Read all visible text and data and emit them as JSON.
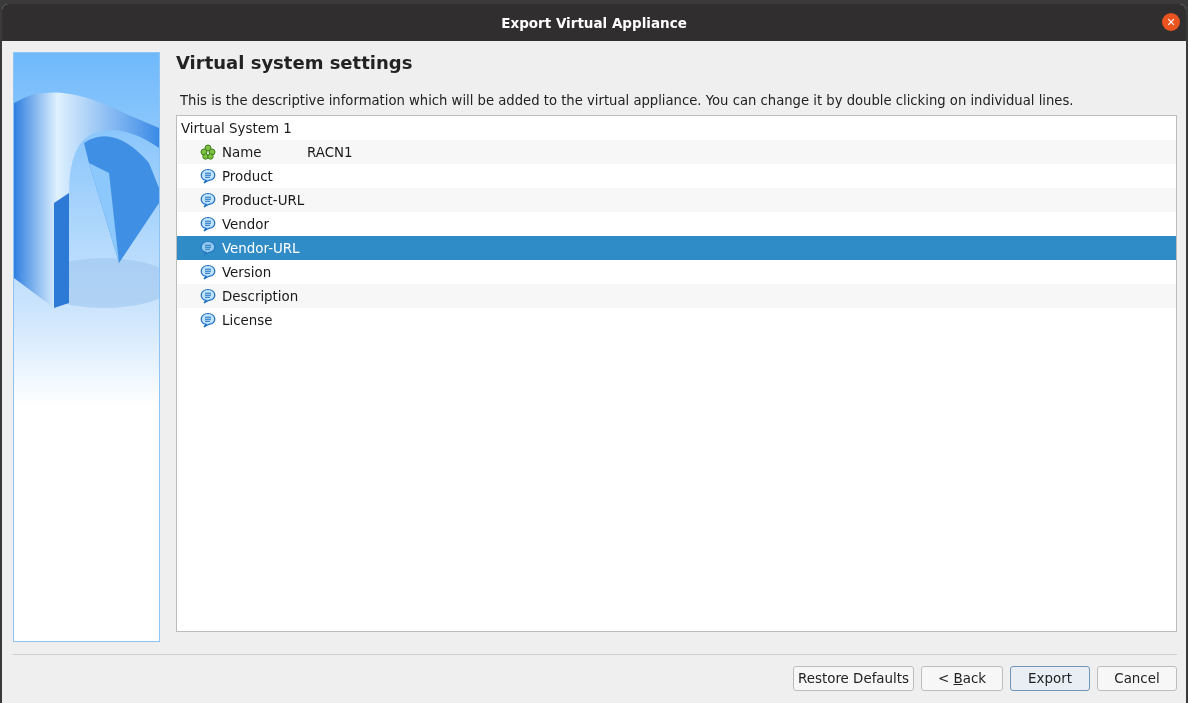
{
  "window": {
    "title": "Export Virtual Appliance",
    "close": "×"
  },
  "heading": "Virtual system settings",
  "description": "This is the descriptive information which will be added to the virtual appliance. You can change it by double clicking on individual lines.",
  "tree": {
    "label": "Virtual System 1",
    "selected": false,
    "children": [
      {
        "kind": "name",
        "label": "Name",
        "value": "RACN1",
        "selected": false
      },
      {
        "kind": "text",
        "label": "Product",
        "selected": false
      },
      {
        "kind": "text",
        "label": "Product-URL",
        "selected": false
      },
      {
        "kind": "text",
        "label": "Vendor",
        "selected": false
      },
      {
        "kind": "text",
        "label": "Vendor-URL",
        "selected": true
      },
      {
        "kind": "text",
        "label": "Version",
        "selected": false
      },
      {
        "kind": "text",
        "label": "Description",
        "selected": false
      },
      {
        "kind": "text",
        "label": "License",
        "selected": false
      }
    ]
  },
  "buttons": [
    {
      "label": "Restore Defaults",
      "default": false
    },
    {
      "text_before": "< ",
      "mnemonic": "B",
      "text_after": "ack",
      "default": false
    },
    {
      "label": "Export",
      "default": true
    },
    {
      "label": "Cancel",
      "default": false
    }
  ]
}
